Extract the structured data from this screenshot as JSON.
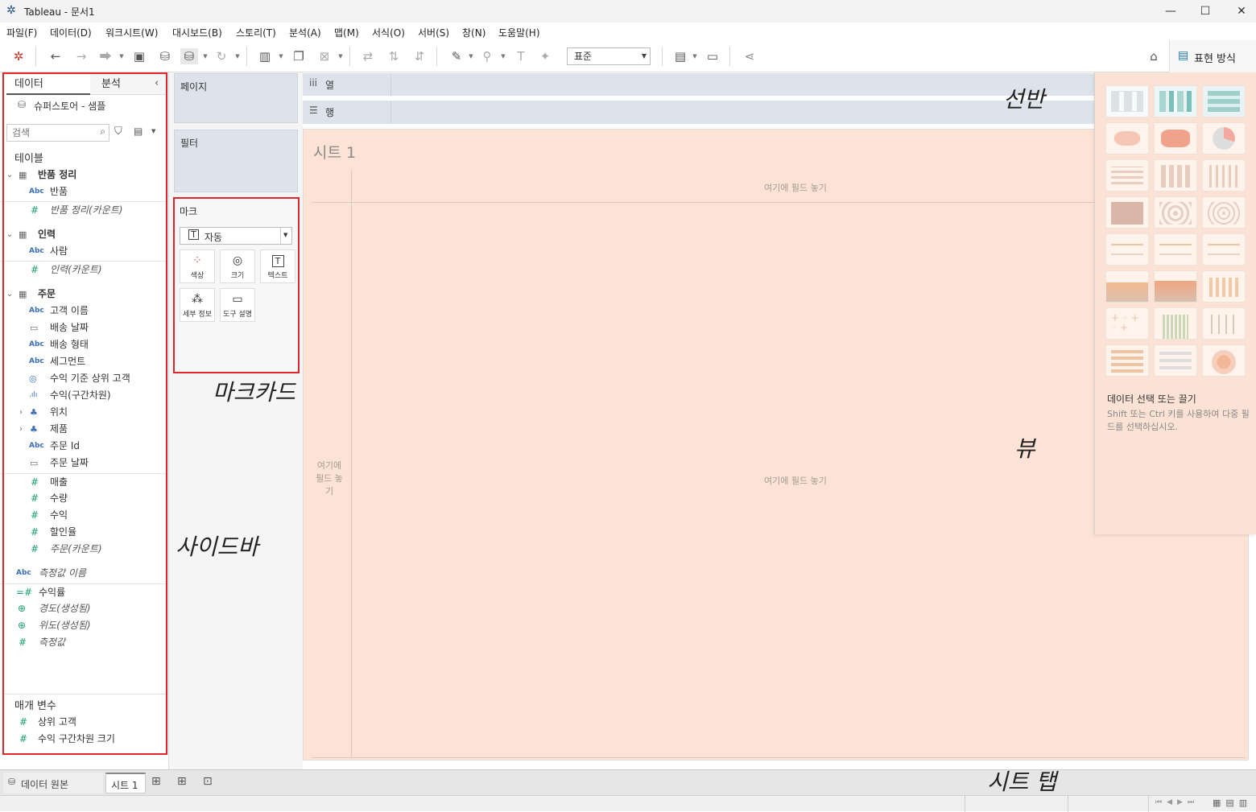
{
  "app": {
    "title": "Tableau - 문서1"
  },
  "menu": [
    "파일(F)",
    "데이터(D)",
    "워크시트(W)",
    "대시보드(B)",
    "스토리(T)",
    "분석(A)",
    "맵(M)",
    "서식(O)",
    "서버(S)",
    "창(N)",
    "도움말(H)"
  ],
  "toolbar": {
    "view_size": "표준",
    "show_me": "표현 방식"
  },
  "sidebar": {
    "tabs": {
      "data": "데이터",
      "analysis": "분석"
    },
    "datasource": "슈퍼스토어 - 샘플",
    "search_placeholder": "검색",
    "tables_header": "테이블",
    "tables": [
      {
        "name": "반품 정리",
        "fields": [
          {
            "icon": "Abc",
            "name": "반품"
          },
          {
            "icon": "#",
            "name": "반품 정리(카운트)",
            "italic": true
          }
        ]
      },
      {
        "name": "인력",
        "fields": [
          {
            "icon": "Abc",
            "name": "사람"
          },
          {
            "icon": "#",
            "name": "인력(카운트)",
            "italic": true
          }
        ]
      },
      {
        "name": "주문",
        "fields": [
          {
            "icon": "Abc",
            "name": "고객 이름"
          },
          {
            "icon": "date",
            "name": "배송 날짜"
          },
          {
            "icon": "Abc",
            "name": "배송 형태"
          },
          {
            "icon": "Abc",
            "name": "세그먼트"
          },
          {
            "icon": "set",
            "name": "수익 기준 상위 고객"
          },
          {
            "icon": "bin",
            "name": "수익(구간차원)"
          },
          {
            "icon": "geo",
            "name": "위치"
          },
          {
            "icon": "geo",
            "name": "제품"
          },
          {
            "icon": "Abc",
            "name": "주문 Id"
          },
          {
            "icon": "date",
            "name": "주문 날짜"
          },
          {
            "icon": "#",
            "name": "매출"
          },
          {
            "icon": "#",
            "name": "수량"
          },
          {
            "icon": "#",
            "name": "수익"
          },
          {
            "icon": "#",
            "name": "할인율"
          },
          {
            "icon": "#",
            "name": "주문(카운트)",
            "italic": true
          }
        ]
      }
    ],
    "extra_fields": [
      {
        "icon": "Abc",
        "name": "측정값 이름",
        "italic": true
      },
      {
        "icon": "=#",
        "name": "수익률"
      },
      {
        "icon": "globe",
        "name": "경도(생성됨)",
        "italic": true
      },
      {
        "icon": "globe",
        "name": "위도(생성됨)",
        "italic": true
      },
      {
        "icon": "#",
        "name": "측정값",
        "italic": true
      }
    ],
    "parameters_header": "매개 변수",
    "parameters": [
      "상위 고객",
      "수익 구간차원 크기"
    ]
  },
  "cards": {
    "pages": "페이지",
    "filters": "필터",
    "marks": "마크",
    "mark_type": "자동",
    "mark_buttons": [
      "색상",
      "크기",
      "텍스트",
      "세부 정보",
      "도구 설명"
    ]
  },
  "shelves": {
    "columns": "열",
    "rows": "행"
  },
  "view": {
    "sheet_title": "시트 1",
    "drop_top": "여기에 필드 놓기",
    "drop_center": "여기에 필드 놓기",
    "drop_left": "여기에 필드 놓기"
  },
  "showme": {
    "hint_title": "데이터 선택 또는 끌기",
    "hint_body": "Shift 또는 Ctrl 키를 사용하여 다중 필드를 선택하십시오."
  },
  "sheet_tabs": {
    "datasource": "데이터 원본",
    "sheet1": "시트 1"
  },
  "annotations": {
    "shelf": "선반",
    "marks_card": "마크카드",
    "view": "뷰",
    "sidebar": "사이드바",
    "sheet_tabs": "시트 탭"
  },
  "colors": {
    "highlight": "#e0262d",
    "view_bg": "#fde3d6",
    "shelf_bg": "#dde3ea"
  }
}
